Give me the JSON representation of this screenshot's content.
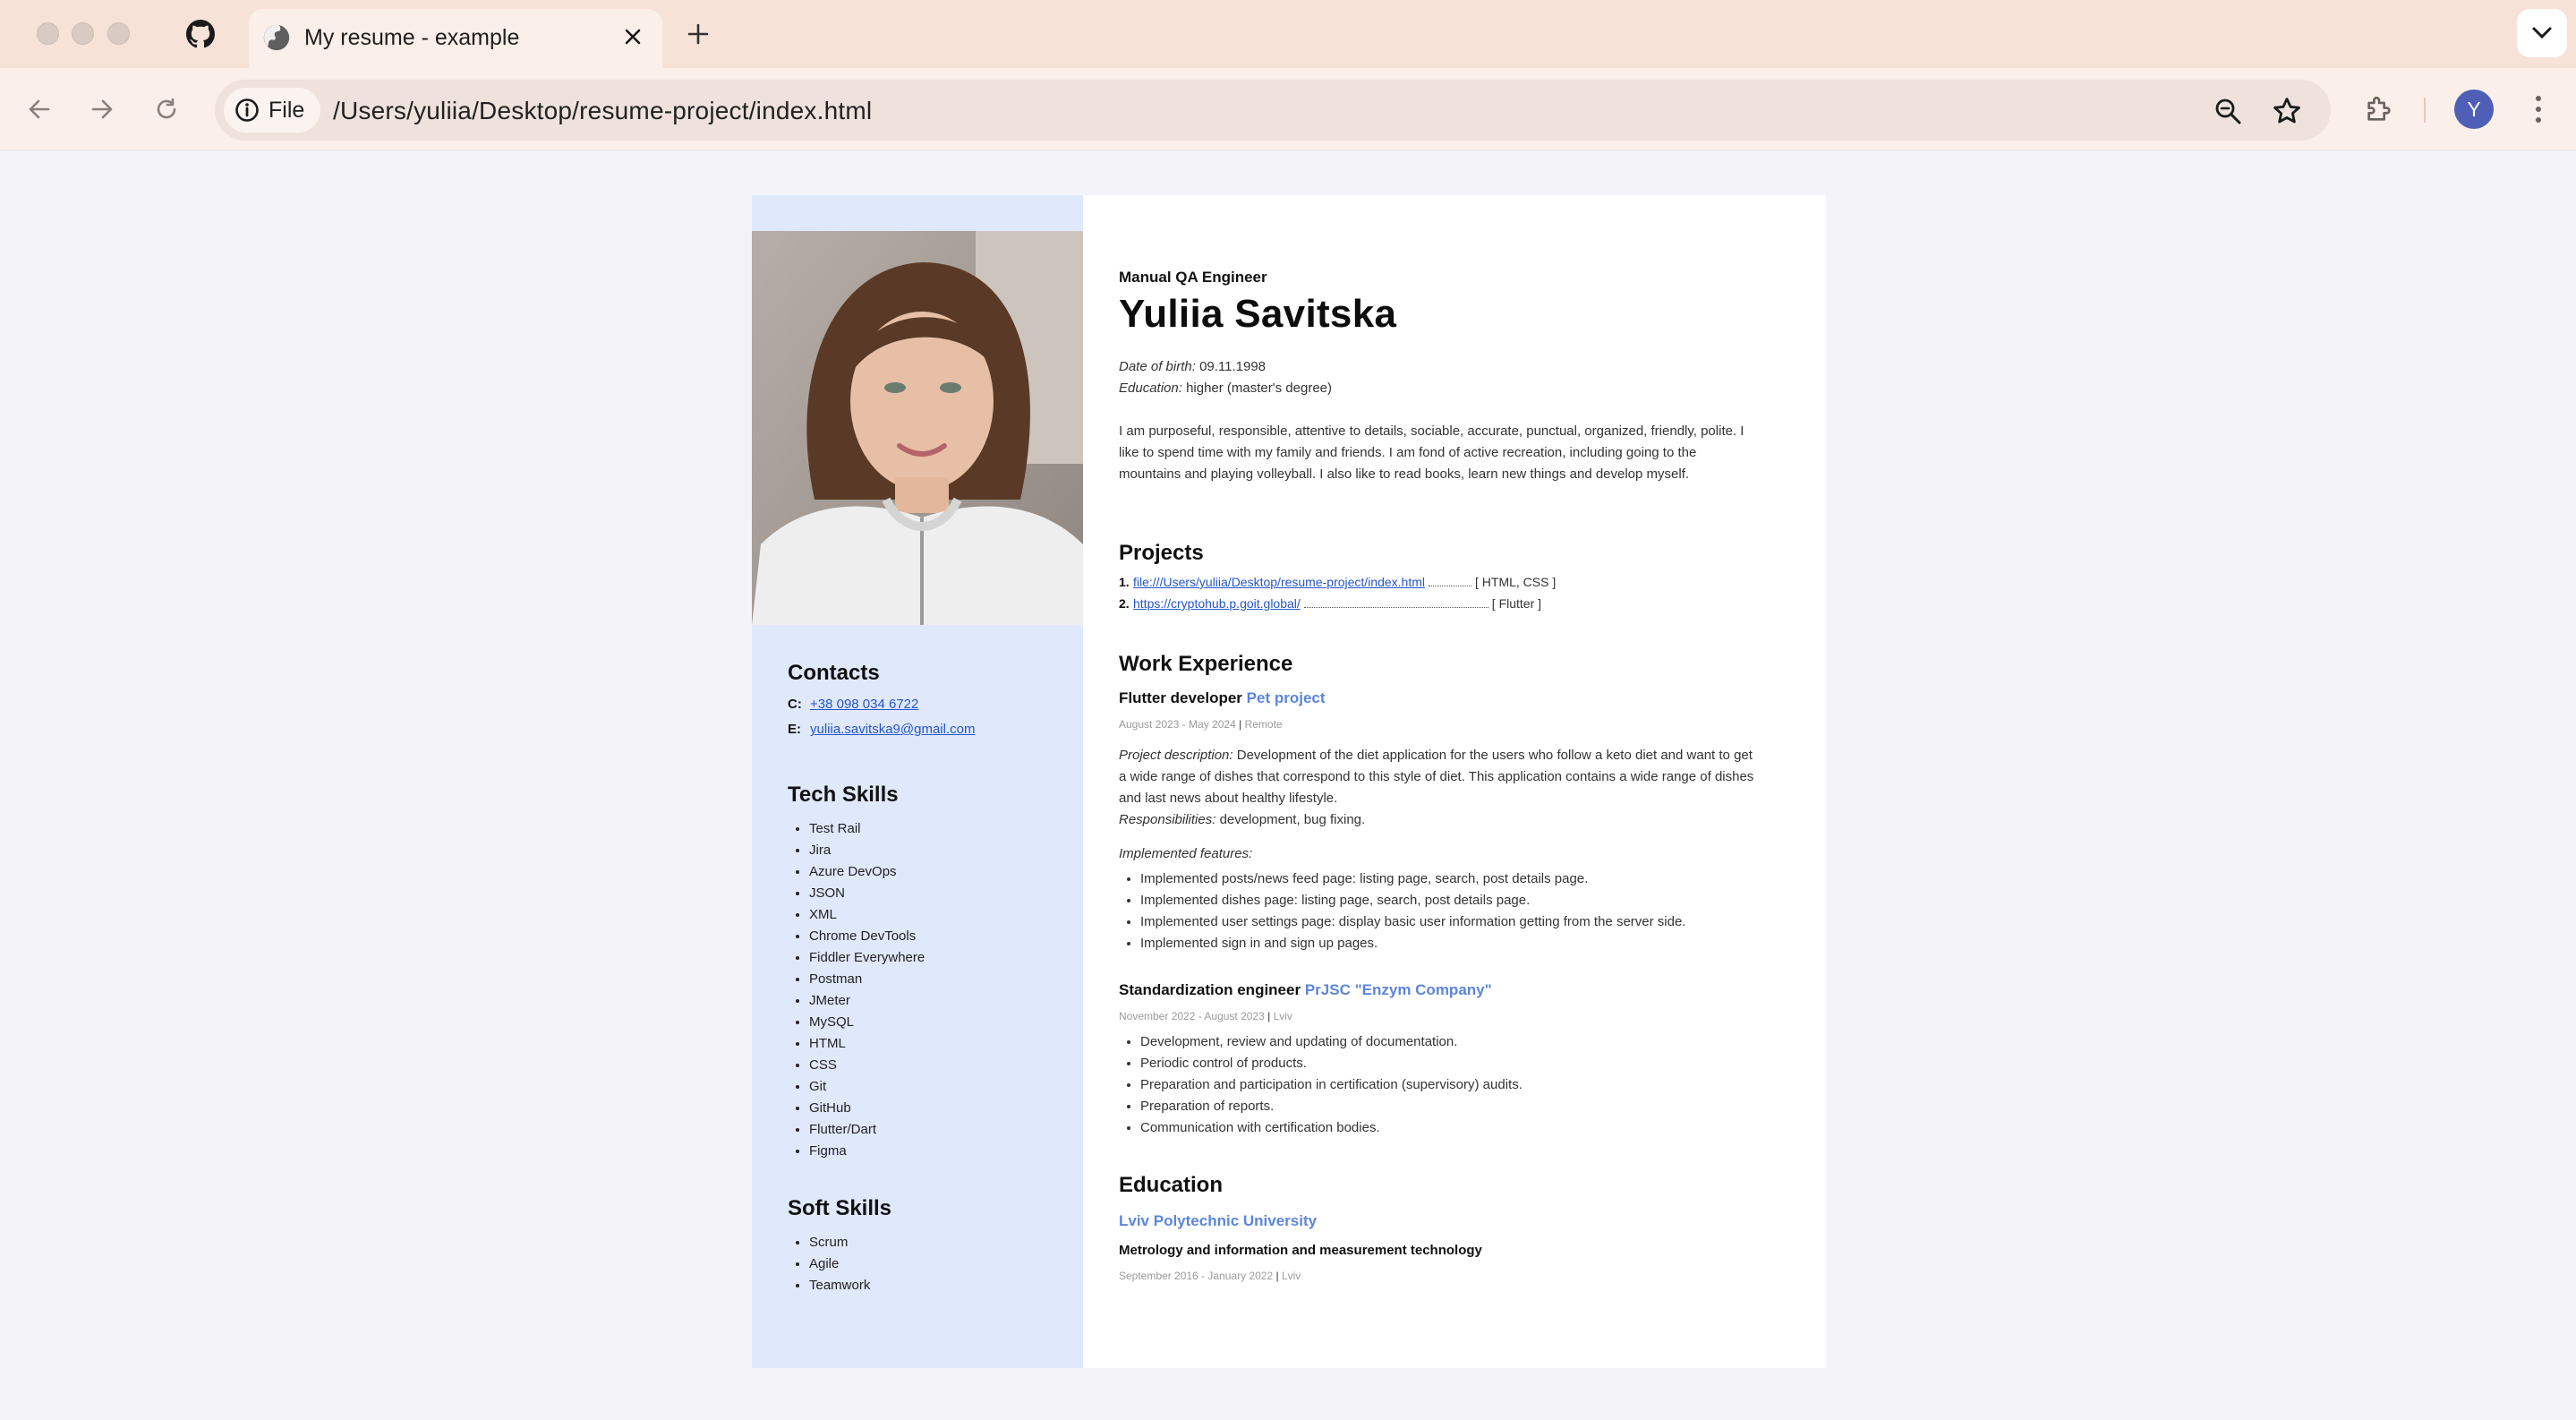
{
  "browser": {
    "tab_title": "My resume - example",
    "chip_label": "File",
    "url": "/Users/yuliia/Desktop/resume-project/index.html",
    "avatar_letter": "Y"
  },
  "resume": {
    "role": "Manual QA Engineer",
    "name": "Yuliia Savitska",
    "dob_label": "Date of birth:",
    "dob_value": "09.11.1998",
    "education_label": "Education:",
    "education_value": "higher (master's degree)",
    "about": "I am purposeful, responsible, attentive to details, sociable, accurate, punctual, organized, friendly, polite. I like to spend time with my family and friends. I am fond of active recreation, including going to the mountains and playing volleyball. I also like to read books, learn new things and develop myself.",
    "projects_title": "Projects",
    "projects": [
      {
        "num": "1.",
        "link": "file:///Users/yuliia/Desktop/resume-project/index.html",
        "tech": "[ HTML, CSS ]"
      },
      {
        "num": "2.",
        "link": "https://cryptohub.p.goit.global/",
        "tech": "[ Flutter ]"
      }
    ],
    "work_title": "Work Experience",
    "jobs": [
      {
        "title": "Flutter developer",
        "company": "Pet project",
        "dates": "August 2023 - May 2024",
        "location": "Remote",
        "desc_label": "Project description:",
        "desc": "Development of the diet application for the users who follow a keto diet and want to get a wide range of dishes that correspond to this style of diet. This application contains a wide range of dishes and last news about healthy lifestyle.",
        "resp_label": "Responsibilities:",
        "resp": "development, bug fixing.",
        "features_label": "Implemented features:",
        "features": [
          "Implemented posts/news feed page: listing page, search, post details page.",
          "Implemented dishes page: listing page, search, post details page.",
          "Implemented user settings page: display basic user information getting from the server side.",
          "Implemented sign in and sign up pages."
        ]
      },
      {
        "title": "Standardization engineer",
        "company": "PrJSC \"Enzym Company\"",
        "dates": "November 2022 - August 2023",
        "location": "Lviv",
        "items": [
          "Development, review and updating of documentation.",
          "Periodic control of products.",
          "Preparation and participation in certification (supervisory) audits.",
          "Preparation of reports.",
          "Communication with certification bodies."
        ]
      }
    ],
    "education_title": "Education",
    "school": "Lviv Polytechnic University",
    "degree": "Metrology and information and measurement technology",
    "edu_dates": "September 2016 - January 2022",
    "edu_location": "Lviv",
    "contacts_title": "Contacts",
    "phone_key": "C:",
    "phone": "+38 098 034 6722",
    "email_key": "E:",
    "email": "yuliia.savitska9@gmail.com",
    "tech_title": "Tech Skills",
    "tech_skills": [
      "Test Rail",
      "Jira",
      "Azure DevOps",
      "JSON",
      "XML",
      "Chrome DevTools",
      "Fiddler Everywhere",
      "Postman",
      "JMeter",
      "MySQL",
      "HTML",
      "CSS",
      "Git",
      "GitHub",
      "Flutter/Dart",
      "Figma"
    ],
    "soft_title": "Soft Skills",
    "soft_skills": [
      "Scrum",
      "Agile",
      "Teamwork"
    ]
  },
  "icons": {
    "pinned_tab": "github-icon",
    "favicon": "globe-icon",
    "info": "info-icon",
    "colors": {
      "accent": "#5b86dc",
      "link": "#2456c9",
      "sidebar": "#e0e8fb",
      "avatar": "#4f5fb8"
    }
  }
}
